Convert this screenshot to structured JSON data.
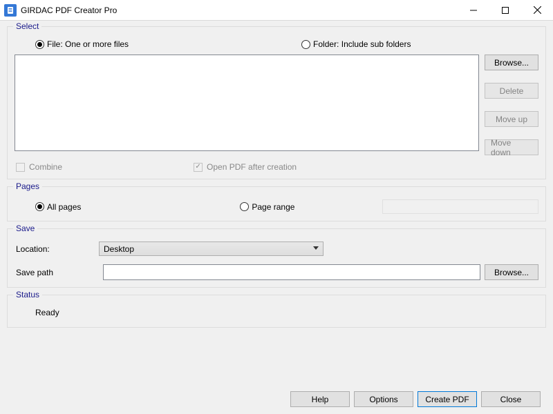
{
  "title": "GIRDAC PDF Creator Pro",
  "select": {
    "legend": "Select",
    "radio_file": "File: One or more files",
    "radio_folder": "Folder: Include sub folders",
    "browse": "Browse...",
    "delete": "Delete",
    "move_up": "Move up",
    "move_down": "Move down",
    "combine": "Combine",
    "open_after": "Open PDF after creation"
  },
  "pages": {
    "legend": "Pages",
    "all": "All pages",
    "range": "Page range"
  },
  "save": {
    "legend": "Save",
    "location_label": "Location:",
    "location_value": "Desktop",
    "savepath_label": "Save path",
    "browse": "Browse..."
  },
  "status": {
    "legend": "Status",
    "text": "Ready"
  },
  "footer": {
    "help": "Help",
    "options": "Options",
    "create": "Create PDF",
    "close": "Close"
  }
}
